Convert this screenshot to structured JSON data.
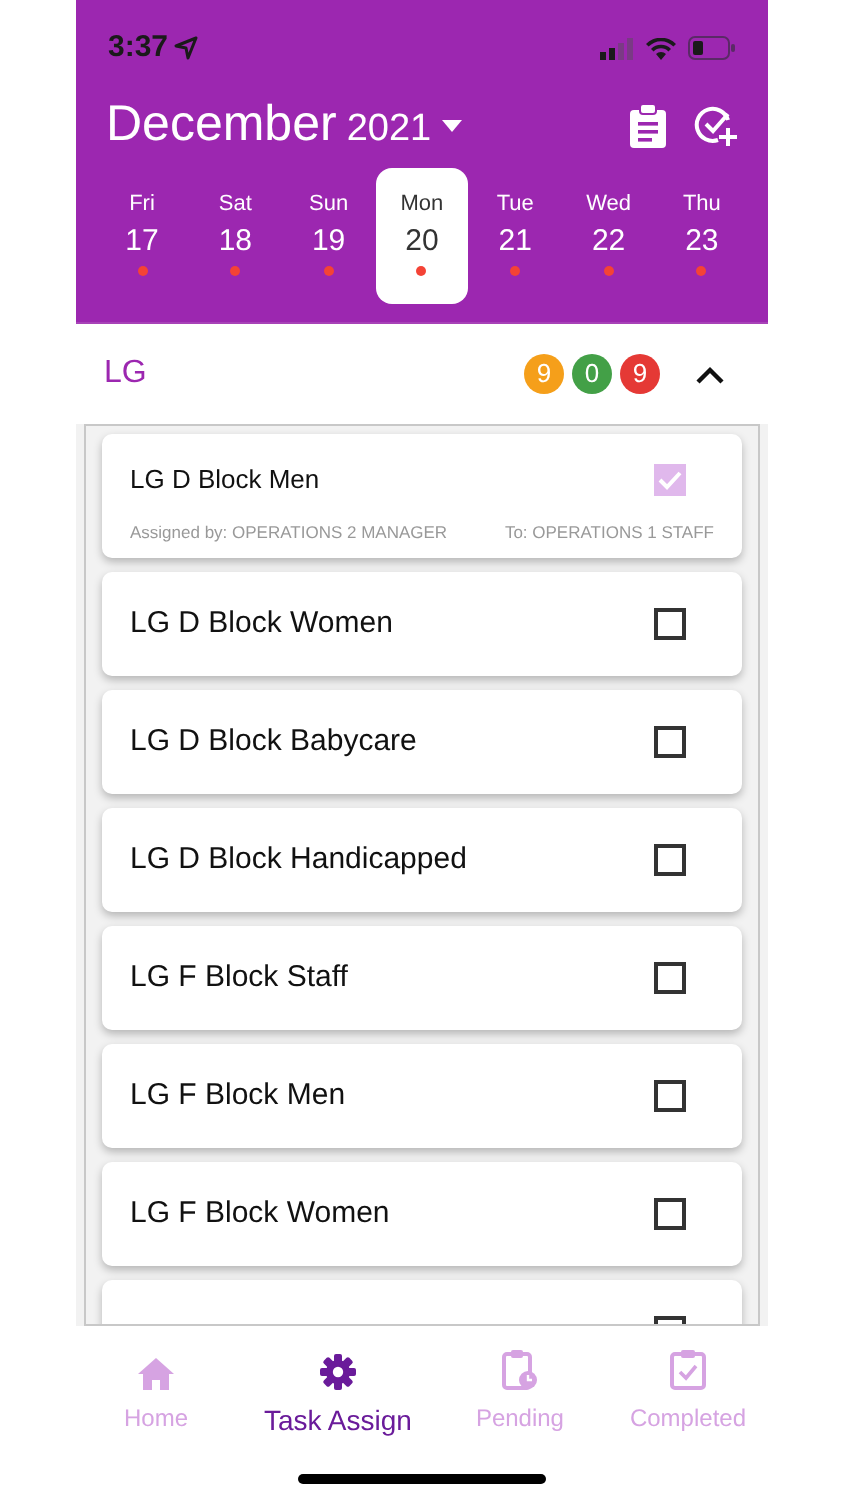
{
  "status_bar": {
    "time": "3:37"
  },
  "header": {
    "month": "December",
    "year": "2021"
  },
  "days": [
    {
      "weekday": "Fri",
      "date": "17",
      "selected": false
    },
    {
      "weekday": "Sat",
      "date": "18",
      "selected": false
    },
    {
      "weekday": "Sun",
      "date": "19",
      "selected": false
    },
    {
      "weekday": "Mon",
      "date": "20",
      "selected": true
    },
    {
      "weekday": "Tue",
      "date": "21",
      "selected": false
    },
    {
      "weekday": "Wed",
      "date": "22",
      "selected": false
    },
    {
      "weekday": "Thu",
      "date": "23",
      "selected": false
    }
  ],
  "section": {
    "title": "LG",
    "expanded": true,
    "counts": [
      {
        "value": "9",
        "color": "#f59f1a"
      },
      {
        "value": "0",
        "color": "#43a047"
      },
      {
        "value": "9",
        "color": "#e53935"
      }
    ]
  },
  "tasks": [
    {
      "title": "LG D Block Men",
      "checked": true,
      "assigned_by": "Assigned by: OPERATIONS 2 MANAGER",
      "assigned_to": "To: OPERATIONS 1 STAFF"
    },
    {
      "title": "LG D Block Women",
      "checked": false
    },
    {
      "title": "LG D Block Babycare",
      "checked": false
    },
    {
      "title": "LG D Block Handicapped",
      "checked": false
    },
    {
      "title": "LG F Block Staff",
      "checked": false
    },
    {
      "title": "LG F Block Men",
      "checked": false
    },
    {
      "title": "LG F Block Women",
      "checked": false
    },
    {
      "checked": false
    }
  ],
  "nav": [
    {
      "label": "Home",
      "kind": "home",
      "selected": false
    },
    {
      "label": "Task Assign",
      "kind": "gear",
      "selected": true
    },
    {
      "label": "Pending",
      "kind": "pending",
      "selected": false
    },
    {
      "label": "Completed",
      "kind": "completed",
      "selected": false
    }
  ]
}
